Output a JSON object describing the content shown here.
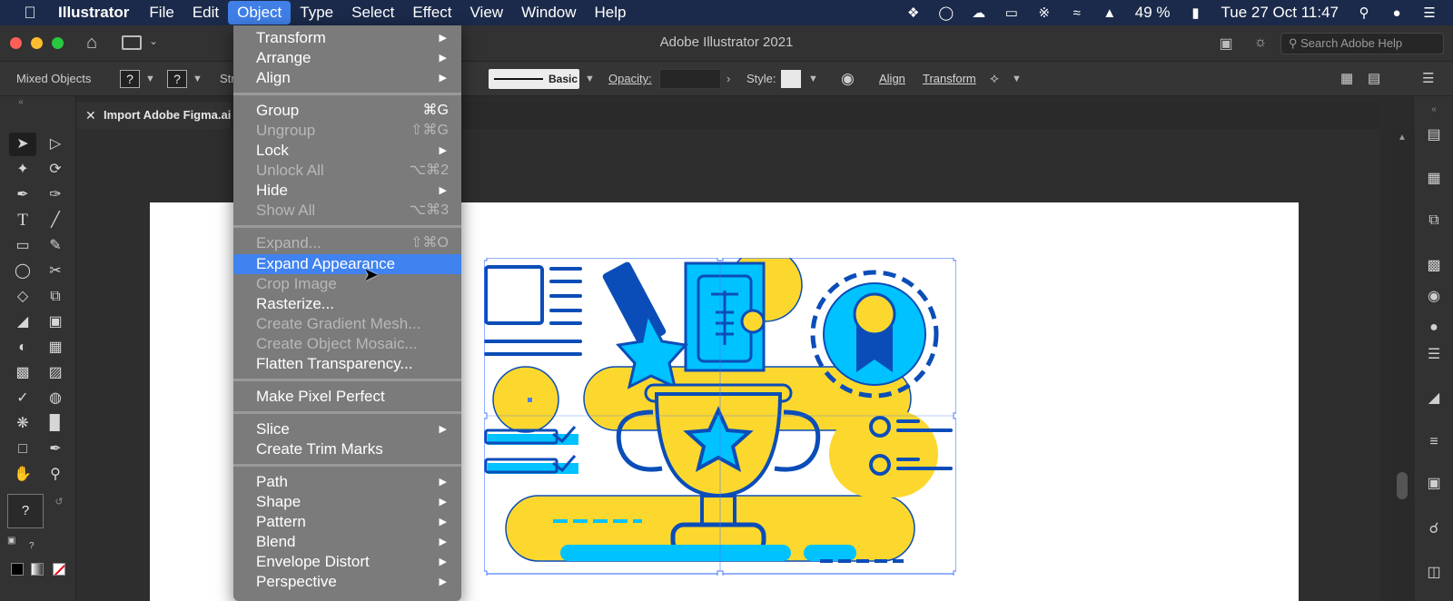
{
  "menubar": {
    "app": "Illustrator",
    "items": [
      "File",
      "Edit",
      "Object",
      "Type",
      "Select",
      "Effect",
      "View",
      "Window",
      "Help"
    ],
    "battery": "49 %",
    "datetime": "Tue 27 Oct  11:47"
  },
  "titlebar": {
    "title": "Adobe Illustrator 2021",
    "search_placeholder": "Search Adobe Help"
  },
  "controlbar": {
    "selection": "Mixed Objects",
    "q1": "?",
    "q2": "?",
    "stroke_prefix": "Str",
    "stroke_profile": "Basic",
    "opacity_label": "Opacity:",
    "style_label": "Style:",
    "align": "Align",
    "transform": "Transform"
  },
  "document": {
    "tab": "Import Adobe Figma.ai"
  },
  "toolbar": {
    "fill_stroke_question": "?",
    "q_small": "?"
  },
  "object_menu": {
    "items": [
      {
        "label": "Transform",
        "shortcut": "",
        "submenu": true,
        "enabled": true
      },
      {
        "label": "Arrange",
        "shortcut": "",
        "submenu": true,
        "enabled": true
      },
      {
        "label": "Align",
        "shortcut": "",
        "submenu": true,
        "enabled": true
      },
      {
        "label": "Group",
        "shortcut": "⌘G",
        "submenu": false,
        "enabled": true
      },
      {
        "label": "Ungroup",
        "shortcut": "⇧⌘G",
        "submenu": false,
        "enabled": false
      },
      {
        "label": "Lock",
        "shortcut": "",
        "submenu": true,
        "enabled": true
      },
      {
        "label": "Unlock All",
        "shortcut": "⌥⌘2",
        "submenu": false,
        "enabled": false
      },
      {
        "label": "Hide",
        "shortcut": "",
        "submenu": true,
        "enabled": true
      },
      {
        "label": "Show All",
        "shortcut": "⌥⌘3",
        "submenu": false,
        "enabled": false
      },
      {
        "label": "Expand...",
        "shortcut": "⇧⌘O",
        "submenu": false,
        "enabled": false
      },
      {
        "label": "Expand Appearance",
        "shortcut": "",
        "submenu": false,
        "enabled": true,
        "highlighted": true
      },
      {
        "label": "Crop Image",
        "shortcut": "",
        "submenu": false,
        "enabled": false
      },
      {
        "label": "Rasterize...",
        "shortcut": "",
        "submenu": false,
        "enabled": true
      },
      {
        "label": "Create Gradient Mesh...",
        "shortcut": "",
        "submenu": false,
        "enabled": false
      },
      {
        "label": "Create Object Mosaic...",
        "shortcut": "",
        "submenu": false,
        "enabled": false
      },
      {
        "label": "Flatten Transparency...",
        "shortcut": "",
        "submenu": false,
        "enabled": true
      },
      {
        "label": "Make Pixel Perfect",
        "shortcut": "",
        "submenu": false,
        "enabled": true
      },
      {
        "label": "Slice",
        "shortcut": "",
        "submenu": true,
        "enabled": true
      },
      {
        "label": "Create Trim Marks",
        "shortcut": "",
        "submenu": false,
        "enabled": true
      },
      {
        "label": "Path",
        "shortcut": "",
        "submenu": true,
        "enabled": true
      },
      {
        "label": "Shape",
        "shortcut": "",
        "submenu": true,
        "enabled": true
      },
      {
        "label": "Pattern",
        "shortcut": "",
        "submenu": true,
        "enabled": true
      },
      {
        "label": "Blend",
        "shortcut": "",
        "submenu": true,
        "enabled": true
      },
      {
        "label": "Envelope Distort",
        "shortcut": "",
        "submenu": true,
        "enabled": true
      },
      {
        "label": "Perspective",
        "shortcut": "",
        "submenu": true,
        "enabled": true
      }
    ]
  },
  "colors": {
    "menubar_bg": "#1b2a4a",
    "menu_highlight": "#3f82f0",
    "illustration_yellow": "#fcd82e",
    "illustration_cyan": "#00c2ff",
    "illustration_blue": "#0b4db8",
    "selection_blue": "#4a7bff"
  }
}
